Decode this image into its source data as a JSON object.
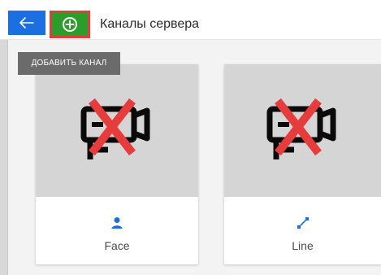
{
  "header": {
    "title": "Каналы сервера",
    "back_icon": "arrow-left-icon",
    "add_icon": "plus-circle-icon"
  },
  "tooltip": {
    "text": "ДОБАВИТЬ КАНАЛ"
  },
  "channels": [
    {
      "label": "Face",
      "type_icon": "person-icon",
      "preview_icon": "camera-crossed-icon"
    },
    {
      "label": "Line",
      "type_icon": "line-segment-icon",
      "preview_icon": "camera-crossed-icon"
    }
  ],
  "colors": {
    "accent_blue": "#1c6fe0",
    "add_green": "#2a9d2a",
    "highlight_red": "#e23d3d",
    "cross_red": "#e63c3c"
  }
}
